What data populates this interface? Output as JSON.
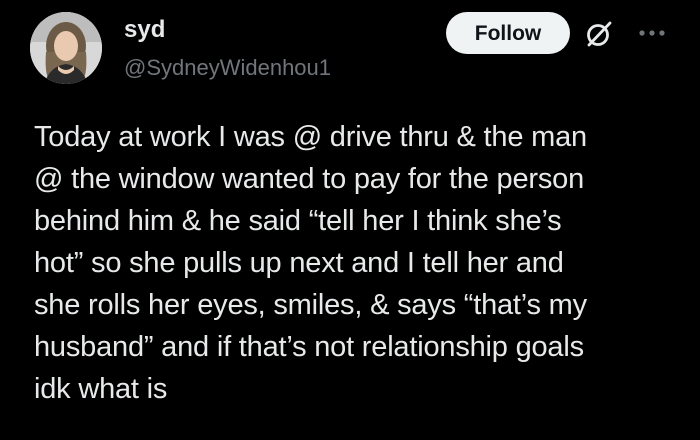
{
  "author": {
    "display_name": "syd",
    "handle": "@SydneyWidenhou1",
    "avatar_icon": "profile-photo"
  },
  "actions": {
    "follow_label": "Follow",
    "grok_icon": "grok-slash-circle-icon",
    "more_icon": "more-dots-icon"
  },
  "tweet": {
    "text": "Today at work I was @ drive thru & the man\n@ the window wanted to pay for the person\nbehind him & he said “tell her I think she’s\nhot” so she pulls up next and I tell her and\nshe rolls her eyes, smiles, & says “that’s my\nhusband” and if that’s not relationship goals\nidk what is"
  },
  "colors": {
    "background": "#000000",
    "primary_text": "#e7e9ea",
    "secondary_text": "#71767b",
    "follow_bg": "#eff3f4",
    "follow_text": "#0f1419"
  }
}
